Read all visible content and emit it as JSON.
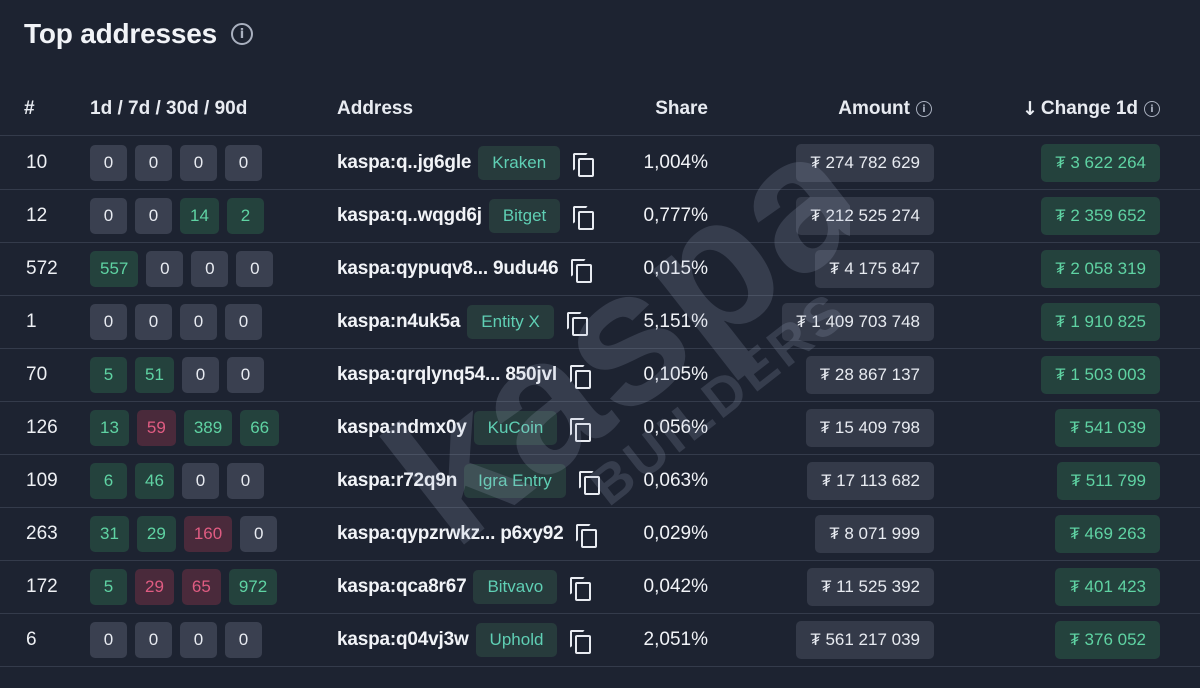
{
  "title": "Top addresses",
  "columns": {
    "rank": "#",
    "periods": "1d / 7d / 30d / 90d",
    "address": "Address",
    "share": "Share",
    "amount": "Amount",
    "change": "Change 1d"
  },
  "watermark": {
    "brand": "kaspa",
    "sub": "BUILDERS"
  },
  "colors": {
    "background": "#1d2331",
    "positive": "#5fd3a3",
    "negative": "#e05c82",
    "neutral_chip": "#3a4050"
  },
  "rows": [
    {
      "rank": "10",
      "periods": [
        {
          "v": "0",
          "k": "zero"
        },
        {
          "v": "0",
          "k": "zero"
        },
        {
          "v": "0",
          "k": "zero"
        },
        {
          "v": "0",
          "k": "zero"
        }
      ],
      "address": "kaspa:q..jg6gle",
      "tag": "Kraken",
      "share": "1,004%",
      "amount": "₮ 274 782 629",
      "change": "₮ 3 622 264"
    },
    {
      "rank": "12",
      "periods": [
        {
          "v": "0",
          "k": "zero"
        },
        {
          "v": "0",
          "k": "zero"
        },
        {
          "v": "14",
          "k": "pos"
        },
        {
          "v": "2",
          "k": "pos"
        }
      ],
      "address": "kaspa:q..wqgd6j",
      "tag": "Bitget",
      "share": "0,777%",
      "amount": "₮ 212 525 274",
      "change": "₮ 2 359 652"
    },
    {
      "rank": "572",
      "periods": [
        {
          "v": "557",
          "k": "pos"
        },
        {
          "v": "0",
          "k": "zero"
        },
        {
          "v": "0",
          "k": "zero"
        },
        {
          "v": "0",
          "k": "zero"
        }
      ],
      "address": "kaspa:qypuqv8... 9udu46",
      "tag": "",
      "share": "0,015%",
      "amount": "₮ 4 175 847",
      "change": "₮ 2 058 319"
    },
    {
      "rank": "1",
      "periods": [
        {
          "v": "0",
          "k": "zero"
        },
        {
          "v": "0",
          "k": "zero"
        },
        {
          "v": "0",
          "k": "zero"
        },
        {
          "v": "0",
          "k": "zero"
        }
      ],
      "address": "kaspa:n4uk5a",
      "tag": "Entity X",
      "share": "5,151%",
      "amount": "₮ 1 409 703 748",
      "change": "₮ 1 910 825"
    },
    {
      "rank": "70",
      "periods": [
        {
          "v": "5",
          "k": "pos"
        },
        {
          "v": "51",
          "k": "pos"
        },
        {
          "v": "0",
          "k": "zero"
        },
        {
          "v": "0",
          "k": "zero"
        }
      ],
      "address": "kaspa:qrqlynq54... 850jvl",
      "tag": "",
      "share": "0,105%",
      "amount": "₮ 28 867 137",
      "change": "₮ 1 503 003"
    },
    {
      "rank": "126",
      "periods": [
        {
          "v": "13",
          "k": "pos"
        },
        {
          "v": "59",
          "k": "neg"
        },
        {
          "v": "389",
          "k": "pos"
        },
        {
          "v": "66",
          "k": "pos"
        }
      ],
      "address": "kaspa:ndmx0y",
      "tag": "KuCoin",
      "share": "0,056%",
      "amount": "₮ 15 409 798",
      "change": "₮ 541 039"
    },
    {
      "rank": "109",
      "periods": [
        {
          "v": "6",
          "k": "pos"
        },
        {
          "v": "46",
          "k": "pos"
        },
        {
          "v": "0",
          "k": "zero"
        },
        {
          "v": "0",
          "k": "zero"
        }
      ],
      "address": "kaspa:r72q9n",
      "tag": "Igra Entry",
      "share": "0,063%",
      "amount": "₮ 17 113 682",
      "change": "₮ 511 799"
    },
    {
      "rank": "263",
      "periods": [
        {
          "v": "31",
          "k": "pos"
        },
        {
          "v": "29",
          "k": "pos"
        },
        {
          "v": "160",
          "k": "neg"
        },
        {
          "v": "0",
          "k": "zero"
        }
      ],
      "address": "kaspa:qypzrwkz... p6xy92",
      "tag": "",
      "share": "0,029%",
      "amount": "₮ 8 071 999",
      "change": "₮ 469 263"
    },
    {
      "rank": "172",
      "periods": [
        {
          "v": "5",
          "k": "pos"
        },
        {
          "v": "29",
          "k": "neg"
        },
        {
          "v": "65",
          "k": "neg"
        },
        {
          "v": "972",
          "k": "pos"
        }
      ],
      "address": "kaspa:qca8r67",
      "tag": "Bitvavo",
      "share": "0,042%",
      "amount": "₮ 11 525 392",
      "change": "₮ 401 423"
    },
    {
      "rank": "6",
      "periods": [
        {
          "v": "0",
          "k": "zero"
        },
        {
          "v": "0",
          "k": "zero"
        },
        {
          "v": "0",
          "k": "zero"
        },
        {
          "v": "0",
          "k": "zero"
        }
      ],
      "address": "kaspa:q04vj3w",
      "tag": "Uphold",
      "share": "2,051%",
      "amount": "₮ 561 217 039",
      "change": "₮ 376 052"
    }
  ]
}
